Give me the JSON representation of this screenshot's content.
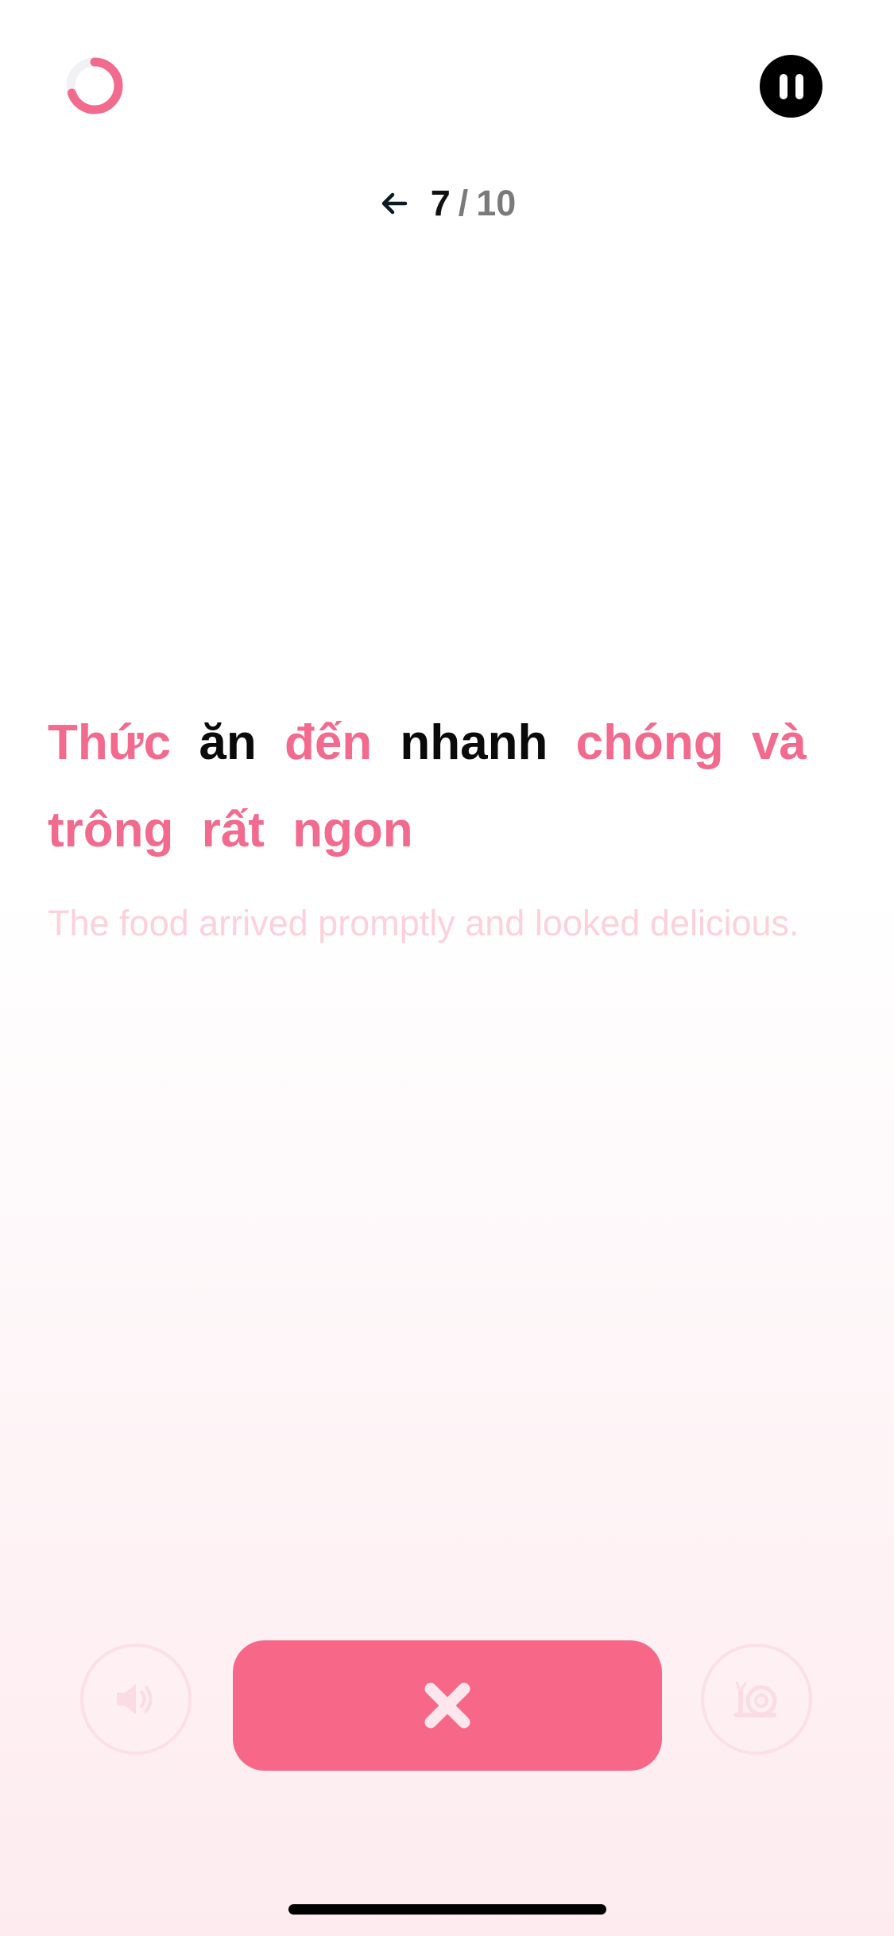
{
  "progress": {
    "fraction": 0.7,
    "color": "#f26a8d",
    "track_color": "#f1f1f4"
  },
  "counter": {
    "current": "7",
    "separator": "/",
    "total": "10"
  },
  "sentence": {
    "words": [
      {
        "text": "Thức",
        "highlight": true
      },
      {
        "text": "ăn",
        "highlight": false
      },
      {
        "text": "đến",
        "highlight": true
      },
      {
        "text": "nhanh",
        "highlight": false
      },
      {
        "text": "chóng",
        "highlight": true
      },
      {
        "text": "và",
        "highlight": true
      },
      {
        "text": "trông",
        "highlight": true
      },
      {
        "text": "rất",
        "highlight": true
      },
      {
        "text": "ngon",
        "highlight": true
      }
    ],
    "translation": "The food arrived promptly and looked delicious."
  },
  "controls": {
    "speaker_icon": "speaker-icon",
    "close_icon": "close-icon",
    "slow_icon": "snail-icon",
    "primary_color": "#f76888"
  }
}
